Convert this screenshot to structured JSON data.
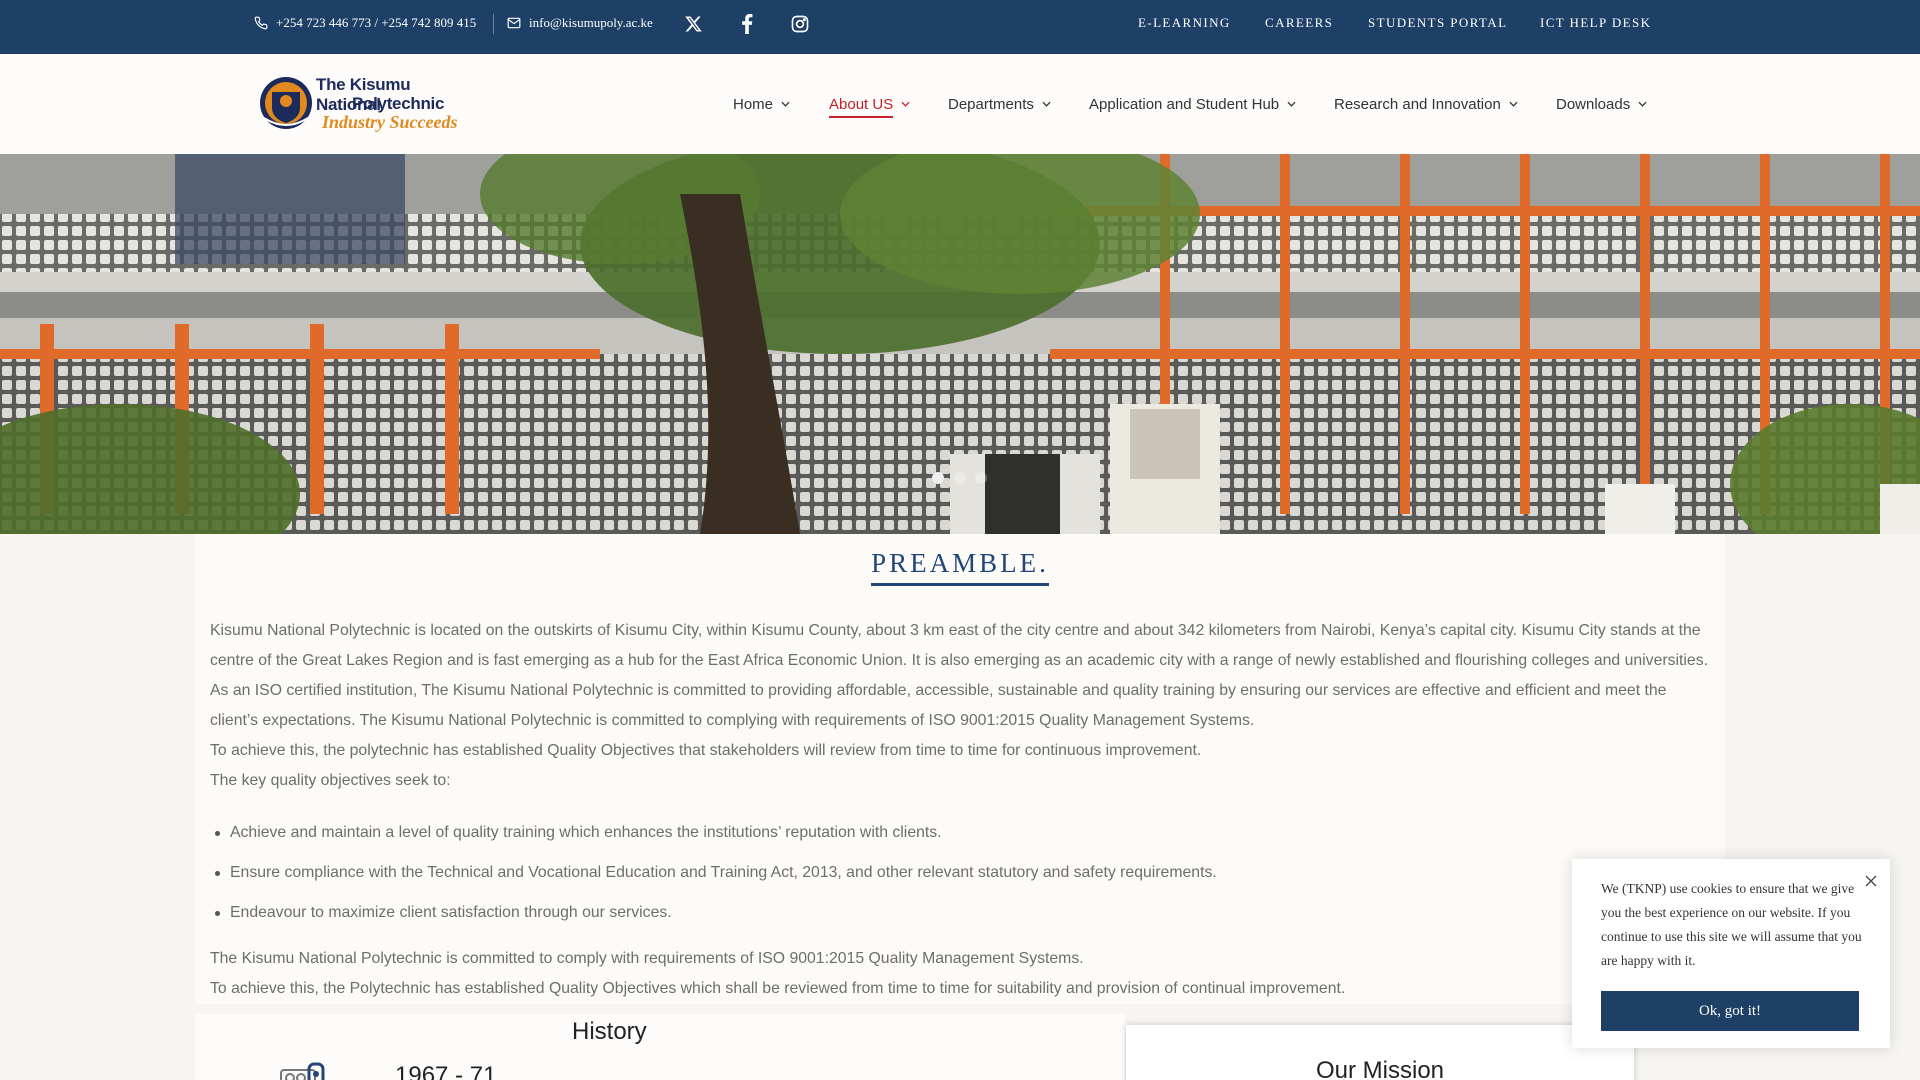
{
  "topbar": {
    "phone": "+254 723 446 773 / +254 742 809 415",
    "email": "info@kisumupoly.ac.ke",
    "social_icons": [
      "x-icon",
      "facebook-icon",
      "instagram-icon"
    ],
    "links": [
      "E-LEARNING",
      "CAREERS",
      "STUDENTS PORTAL",
      "ICT HELP DESK"
    ]
  },
  "logo": {
    "line1": "The Kisumu National",
    "line2": "Polytechnic",
    "tagline": "Industry Succeeds"
  },
  "nav": {
    "items": [
      {
        "label": "Home",
        "active": false
      },
      {
        "label": "About US",
        "active": true
      },
      {
        "label": "Departments",
        "active": false
      },
      {
        "label": "Application and Student Hub",
        "active": false
      },
      {
        "label": "Research and Innovation",
        "active": false
      },
      {
        "label": "Downloads",
        "active": false
      }
    ]
  },
  "hero": {
    "slides": 3,
    "active_slide": 1
  },
  "content": {
    "heading": "PREAMBLE.",
    "para1": "Kisumu National Polytechnic is located on the outskirts of Kisumu City, within Kisumu County, about 3 km east of the city centre and about 342 kilometers from Nairobi, Kenya’s capital city. Kisumu City stands at the centre of the Great Lakes Region and is fast emerging as a hub for the East Africa Economic Union. It is also emerging as an academic city with a range of newly established and flourishing colleges and universities. As an ISO certified institution, The Kisumu National Polytechnic is committed to providing affordable, accessible, sustainable and quality training by ensuring our services are effective and efficient and meet the client’s expectations. The Kisumu National Polytechnic is committed to complying with requirements of ISO 9001:2015 Quality Management Systems.",
    "para2": "To achieve this, the polytechnic has established Quality Objectives that stakeholders will review from time to time for continuous improvement.",
    "para3": "The key quality objectives seek to:",
    "bullets": [
      "Achieve and maintain a level of quality training which enhances the institutions’ reputation with clients.",
      "Ensure compliance with the Technical and Vocational Education and Training Act, 2013, and other relevant statutory and safety requirements.",
      "Endeavour to maximize client satisfaction through our services."
    ],
    "para4": "The Kisumu National Polytechnic is committed to comply with requirements of ISO 9001:2015 Quality Management Systems.",
    "para5": "To achieve this, the Polytechnic has established Quality Objectives which shall be reviewed from time to time for suitability and provision of continual improvement."
  },
  "history": {
    "heading": "History",
    "year": "1967 - 71"
  },
  "mission": {
    "heading": "Our Mission"
  },
  "cookie": {
    "text": "We (TKNP) use cookies to ensure that we give you the best experience on our website. If you continue to use this site we will assume that you are happy with it.",
    "button": "Ok, got it!"
  },
  "colors": {
    "topbar_bg": "#1e3f66",
    "active_nav": "#c8222c",
    "heading_blue": "#23467a",
    "logo_orange": "#e08a1e"
  }
}
